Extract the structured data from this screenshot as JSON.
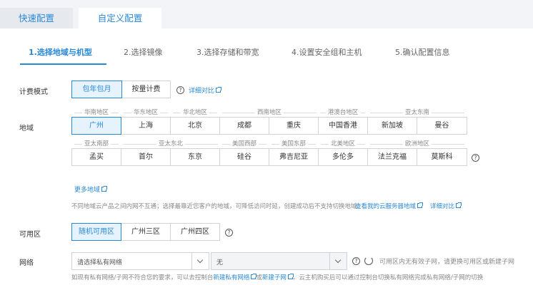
{
  "tabs": [
    {
      "label": "快速配置"
    },
    {
      "label": "自定义配置"
    }
  ],
  "steps": [
    {
      "label": "1.选择地域与机型"
    },
    {
      "label": "2.选择镜像"
    },
    {
      "label": "3.选择存储和带宽"
    },
    {
      "label": "4.设置安全组和主机"
    },
    {
      "label": "5.确认配置信息"
    }
  ],
  "billing": {
    "label": "计费模式",
    "options": [
      "包年包月",
      "按量计费"
    ],
    "detail_link": "详细对比"
  },
  "region": {
    "label": "地域",
    "row1_groups": [
      "华南地区",
      "华东地区",
      "华北地区",
      "西南地区",
      "港澳台地区",
      "亚太东南"
    ],
    "row1": [
      "广州",
      "上海",
      "北京",
      "成都",
      "重庆",
      "中国香港",
      "新加坡",
      "曼谷"
    ],
    "row2_groups": [
      "亚太南部",
      "亚太东北",
      "美国西部",
      "美国东部",
      "北美地区",
      "欧洲地区"
    ],
    "row2": [
      "孟买",
      "首尔",
      "东京",
      "硅谷",
      "弗吉尼亚",
      "多伦多",
      "法兰克福",
      "莫斯科"
    ],
    "more_link": "更多地域",
    "notice": "不同地域云产品之间内网不互通；选择最靠近您客户的地域，可降低访问时延，创建成功后不支持切换地域。",
    "server_link": "查看我的云服务器地域",
    "detail_link": "详细对比"
  },
  "zone": {
    "label": "可用区",
    "options": [
      "随机可用区",
      "广州三区",
      "广州四区"
    ]
  },
  "network": {
    "label": "网络",
    "vpc_placeholder": "请选择私有网络",
    "subnet_value": "无",
    "hint": "可用区内无有效子网，请更换可用区或新建子网",
    "footer_prefix": "如现有私有网络/子网不符合您的要求，可以去控制台",
    "new_vpc_link": "新建私有网络",
    "or": "或",
    "new_subnet_link": "新建子网",
    "footer_suffix": "。云主机购买后可以通过控制台切换私有网络完成私有网络/子网的切换"
  },
  "colors": {
    "accent": "#2a89d6",
    "selected_bg": "#e6f3fc"
  }
}
